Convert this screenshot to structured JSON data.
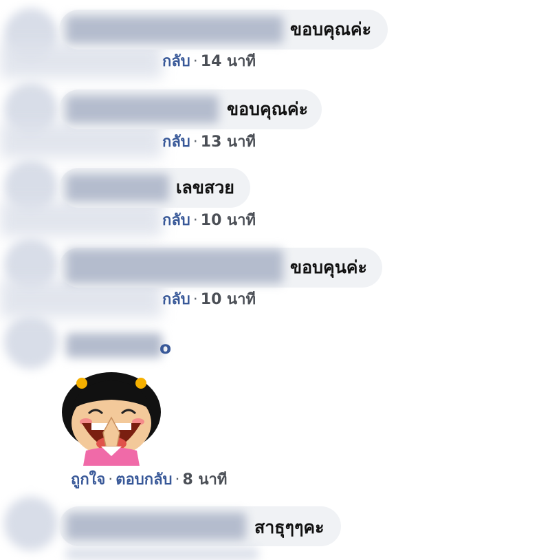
{
  "comments": [
    {
      "text": "ขอบคุณค่ะ",
      "reply_fragment": "กลับ",
      "time": "14 นาที"
    },
    {
      "text": "ขอบคุณค่ะ",
      "reply_fragment": "กลับ",
      "time": "13 นาที"
    },
    {
      "text": "เลขสวย",
      "reply_fragment": "กลับ",
      "time": "10 นาที"
    },
    {
      "text": "ขอบคุนค่ะ",
      "reply_fragment": "กลับ",
      "time": "10 นาที"
    },
    {
      "name_fragment": "o"
    },
    {
      "text": "สาธุๆๆคะ"
    }
  ],
  "sticker_comment": {
    "like_label": "ถูกใจ",
    "reply_label": "ตอบกลับ",
    "time": "8 นาที",
    "sticker_icon": "cartoon-girl-sticker"
  },
  "separator": "·",
  "colors": {
    "bubble": "#f0f2f5",
    "link": "#385898",
    "meta": "#4b4f56"
  }
}
